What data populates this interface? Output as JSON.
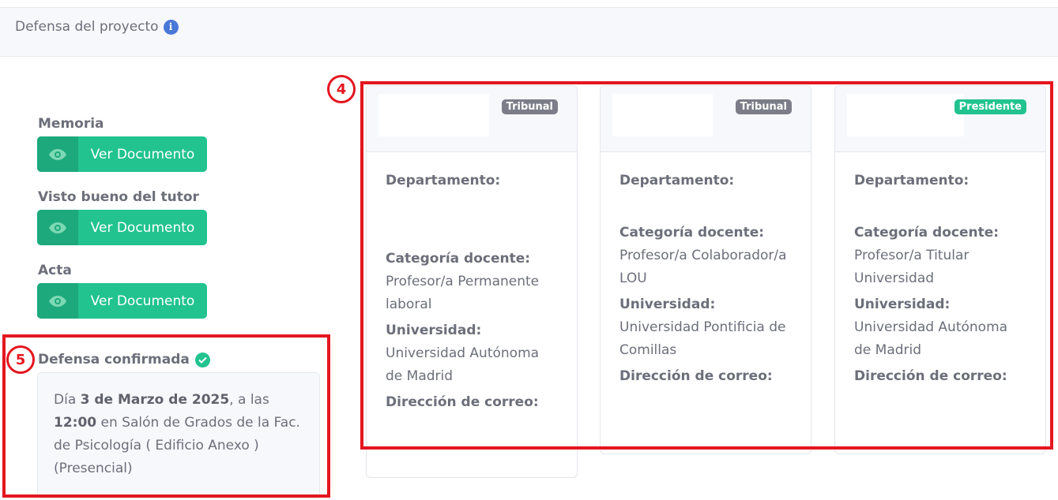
{
  "header": {
    "title": "Defensa del proyecto",
    "info_icon": "info-icon"
  },
  "documents": [
    {
      "label": "Memoria",
      "button": "Ver Documento"
    },
    {
      "label": "Visto bueno del tutor",
      "button": "Ver Documento"
    },
    {
      "label": "Acta",
      "button": "Ver Documento"
    }
  ],
  "confirmation": {
    "title": "Defensa confirmada",
    "prefix": "Día ",
    "date": "3 de Marzo de 2025",
    "middle": ", a las ",
    "time": "12:00",
    "place": "en Salón de Grados de la Fac. de Psicología ( Edificio Anexo ) (Presencial)"
  },
  "tribunal": [
    {
      "badge": "Tribunal",
      "department_label": "Departamento:",
      "department_value": "",
      "category_label": "Categoría docente:",
      "category_value": "Profesor/a Permanente laboral",
      "university_label": "Universidad:",
      "university_value": "Universidad Autónoma de Madrid",
      "email_label": "Dirección de correo:"
    },
    {
      "badge": "Tribunal",
      "department_label": "Departamento:",
      "department_value": "",
      "category_label": "Categoría docente:",
      "category_value": "Profesor/a Colaborador/a LOU",
      "university_label": "Universidad:",
      "university_value": "Universidad Pontificia de Comillas",
      "email_label": "Dirección de correo:"
    },
    {
      "badge": "Presidente",
      "department_label": "Departamento:",
      "department_value": "",
      "category_label": "Categoría docente:",
      "category_value": "Profesor/a Titular Universidad",
      "university_label": "Universidad:",
      "university_value": "Universidad Autónoma de Madrid",
      "email_label": "Dirección de correo:"
    }
  ],
  "annotations": {
    "box4": "4",
    "box5": "5"
  },
  "colors": {
    "accent_green": "#22c38e",
    "badge_grey": "#7b7e88",
    "annotation_red": "#e4161f",
    "info_blue": "#4a78d8"
  }
}
